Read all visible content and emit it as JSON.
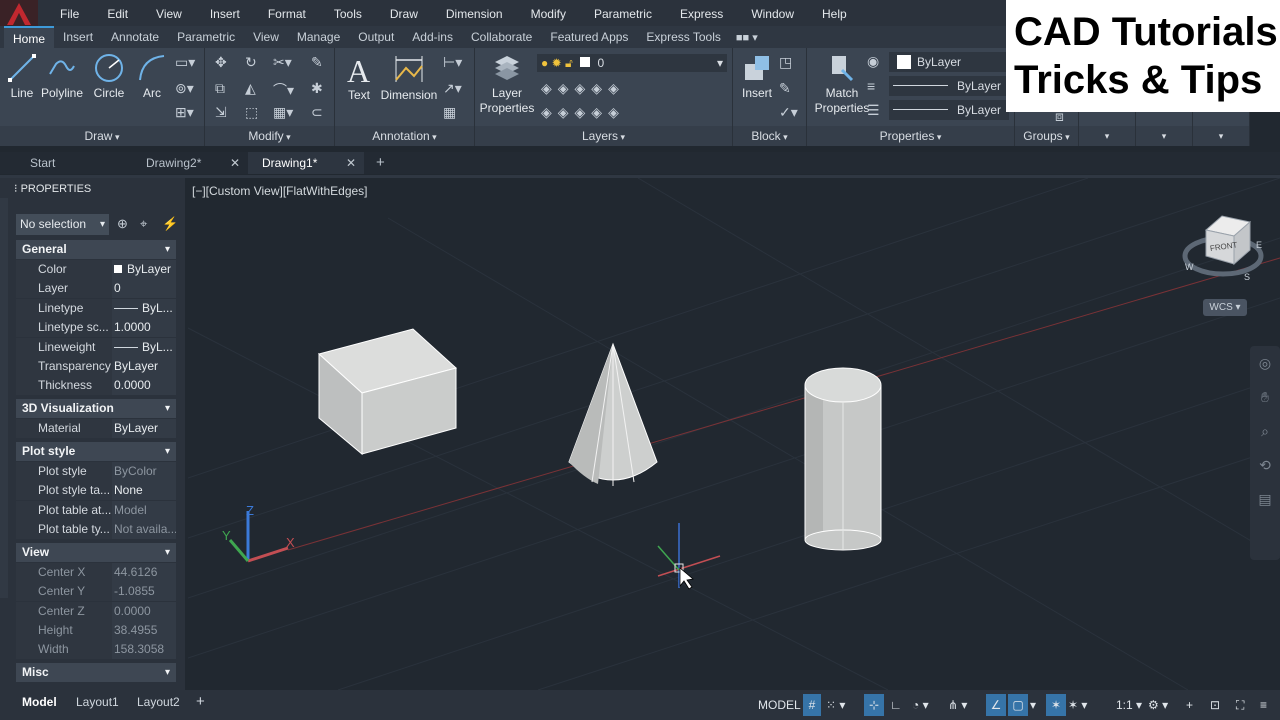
{
  "menu": {
    "items": [
      "File",
      "Edit",
      "View",
      "Insert",
      "Format",
      "Tools",
      "Draw",
      "Dimension",
      "Modify",
      "Parametric",
      "Express",
      "Window",
      "Help"
    ]
  },
  "ribbon_tabs": {
    "items": [
      "Home",
      "Insert",
      "Annotate",
      "Parametric",
      "View",
      "Manage",
      "Output",
      "Add-ins",
      "Collaborate",
      "Featured Apps",
      "Express Tools"
    ],
    "active": "Home"
  },
  "ribbon": {
    "draw": {
      "title": "Draw",
      "tools": [
        "Line",
        "Polyline",
        "Circle",
        "Arc"
      ]
    },
    "modify": {
      "title": "Modify"
    },
    "annotation": {
      "title": "Annotation",
      "tools": [
        "Text",
        "Dimension"
      ]
    },
    "layers": {
      "title": "Layers",
      "tool": "Layer Properties",
      "current_layer": "0"
    },
    "block": {
      "title": "Block",
      "tool": "Insert"
    },
    "properties": {
      "title": "Properties",
      "tool": "Match Properties",
      "color": "ByLayer",
      "linetype": "ByLayer",
      "lineweight": "ByLayer"
    },
    "groups": {
      "title": "Groups"
    }
  },
  "watermark": {
    "line1": "CAD Tutorials",
    "line2": "Tricks & Tips"
  },
  "file_tabs": [
    {
      "label": "Start"
    },
    {
      "label": "Drawing2*"
    },
    {
      "label": "Drawing1*"
    }
  ],
  "properties": {
    "title": "PROPERTIES",
    "selection": "No selection",
    "sections": {
      "general": "General",
      "viz": "3D Visualization",
      "plot": "Plot style",
      "view": "View",
      "misc": "Misc"
    },
    "general": [
      {
        "k": "Color",
        "v": "ByLayer"
      },
      {
        "k": "Layer",
        "v": "0"
      },
      {
        "k": "Linetype",
        "v": "ByL..."
      },
      {
        "k": "Linetype sc...",
        "v": "1.0000"
      },
      {
        "k": "Lineweight",
        "v": "ByL..."
      },
      {
        "k": "Transparency",
        "v": "ByLayer"
      },
      {
        "k": "Thickness",
        "v": "0.0000"
      }
    ],
    "viz": [
      {
        "k": "Material",
        "v": "ByLayer"
      }
    ],
    "plot": [
      {
        "k": "Plot style",
        "v": "ByColor"
      },
      {
        "k": "Plot style ta...",
        "v": "None"
      },
      {
        "k": "Plot table at...",
        "v": "Model"
      },
      {
        "k": "Plot table ty...",
        "v": "Not availa..."
      }
    ],
    "view": [
      {
        "k": "Center X",
        "v": "44.6126"
      },
      {
        "k": "Center Y",
        "v": "-1.0855"
      },
      {
        "k": "Center Z",
        "v": "0.0000"
      },
      {
        "k": "Height",
        "v": "38.4955"
      },
      {
        "k": "Width",
        "v": "158.3058"
      }
    ]
  },
  "viewport": {
    "label": "[−][Custom View][FlatWithEdges]",
    "viewcube_face": "FRONT",
    "wcs": "WCS"
  },
  "layout_tabs": [
    "Model",
    "Layout1",
    "Layout2"
  ],
  "status": {
    "model": "MODEL",
    "scale": "1:1"
  },
  "colors": {
    "accent": "#3d9ad9",
    "bg": "#212830",
    "panel": "#3b4552"
  }
}
